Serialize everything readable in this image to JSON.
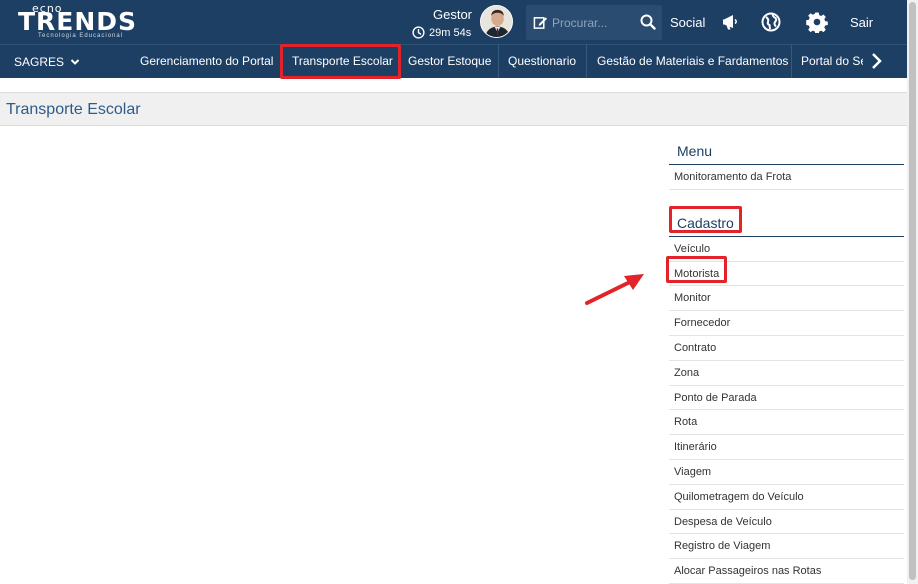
{
  "logo": {
    "top": "ecno",
    "main": "TRENDS",
    "subtitle": "Tecnologia Educacional"
  },
  "header": {
    "user_name": "Gestor",
    "session_timer": "29m 54s",
    "search_placeholder": "Procurar...",
    "social_label": "Social",
    "logout_label": "Sair"
  },
  "nav": {
    "system_label": "SAGRES",
    "items": [
      {
        "label": "Gerenciamento do Portal"
      },
      {
        "label": "Transporte Escolar"
      },
      {
        "label": "Gestor Estoque"
      },
      {
        "label": "Questionario"
      },
      {
        "label": "Gestão de Materiais e Fardamentos"
      },
      {
        "label": "Portal do Se"
      }
    ]
  },
  "page": {
    "title": "Transporte Escolar"
  },
  "side_menu": {
    "menu_heading": "Menu",
    "menu_items": [
      "Monitoramento da Frota"
    ],
    "cadastro_heading": "Cadastro",
    "cadastro_items": [
      "Veículo",
      "Motorista",
      "Monitor",
      "Fornecedor",
      "Contrato",
      "Zona",
      "Ponto de Parada",
      "Rota",
      "Itinerário",
      "Viagem",
      "Quilometragem do Veículo",
      "Despesa de Veículo",
      "Registro de Viagem",
      "Alocar Passageiros nas Rotas"
    ]
  },
  "colors": {
    "header_bg": "#1d3f64",
    "highlight": "#e2232a",
    "title_text": "#2e5c8a"
  }
}
